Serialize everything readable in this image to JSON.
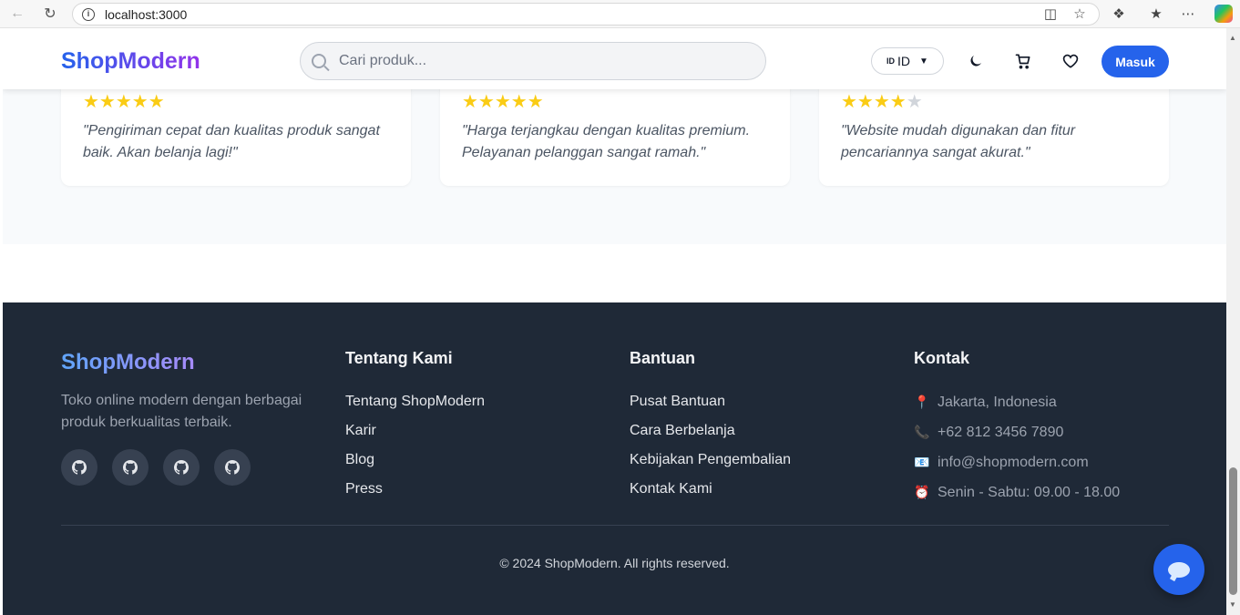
{
  "browser": {
    "url": "localhost:3000"
  },
  "header": {
    "logo": "ShopModern",
    "search_placeholder": "Cari produk...",
    "language_flag": "ID",
    "language_code": "ID",
    "login_label": "Masuk"
  },
  "testimonials": [
    {
      "rating": 5,
      "quote": "\"Pengiriman cepat dan kualitas produk sangat baik. Akan belanja lagi!\""
    },
    {
      "rating": 5,
      "quote": "\"Harga terjangkau dengan kualitas premium. Pelayanan pelanggan sangat ramah.\""
    },
    {
      "rating": 4,
      "quote": "\"Website mudah digunakan dan fitur pencariannya sangat akurat.\""
    }
  ],
  "footer": {
    "logo": "ShopModern",
    "description": "Toko online modern dengan berbagai produk berkualitas terbaik.",
    "about": {
      "title": "Tentang Kami",
      "links": [
        "Tentang ShopModern",
        "Karir",
        "Blog",
        "Press"
      ]
    },
    "help": {
      "title": "Bantuan",
      "links": [
        "Pusat Bantuan",
        "Cara Berbelanja",
        "Kebijakan Pengembalian",
        "Kontak Kami"
      ]
    },
    "contact": {
      "title": "Kontak",
      "items": [
        {
          "icon": "pin-icon",
          "text": "Jakarta, Indonesia"
        },
        {
          "icon": "phone-icon",
          "text": "+62 812 3456 7890"
        },
        {
          "icon": "email-icon",
          "text": "info@shopmodern.com"
        },
        {
          "icon": "alarm-clock-icon",
          "text": "Senin - Sabtu: 09.00 - 18.00"
        }
      ]
    },
    "copyright": "© 2024 ShopModern. All rights reserved."
  },
  "colors": {
    "primary": "#2563eb",
    "footer_bg": "#1f2937",
    "star": "#facc15"
  }
}
